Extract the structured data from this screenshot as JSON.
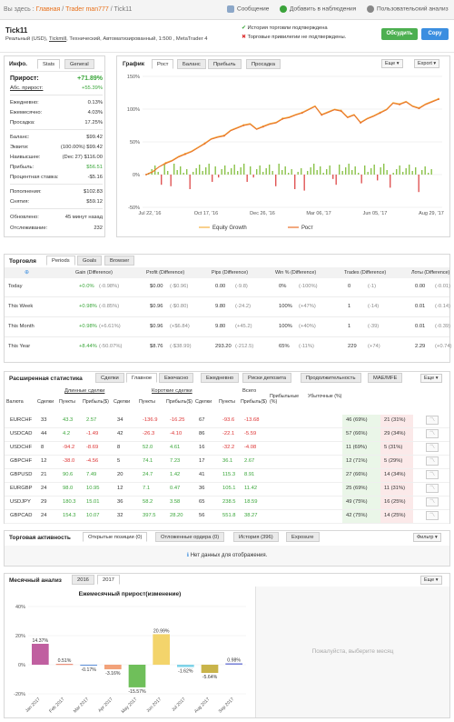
{
  "breadcrumb": {
    "prefix": "Вы здесь",
    "home": "Главная",
    "user": "Trader man777",
    "page": "Tick11"
  },
  "topbar": {
    "message": "Сообщение",
    "watch": "Добавить в наблюдения",
    "analysis": "Пользовательский анализ"
  },
  "account": {
    "name": "Tick11",
    "details_pre": "Реальный (USD), ",
    "broker": "Tickmill",
    "details_post": ", Технический, Автоматизированный, 1:500 , MetaTrader 4",
    "verify1": "История торговли подтверждена",
    "verify2": "Торговые привилегии не подтверждены.",
    "discuss": "Обсудить",
    "copy": "Copy"
  },
  "info": {
    "title": "Инфо.",
    "tabs": [
      "Stats",
      "General"
    ],
    "gain_label": "Прирост:",
    "gain": "+71.89%",
    "abs_label": "Абс. прирост:",
    "abs": "+55.39%",
    "daily_label": "Ежедневно:",
    "daily": "0.13%",
    "monthly_label": "Ежемесячно:",
    "monthly": "4.03%",
    "dd_label": "Просадка:",
    "dd": "17.25%",
    "balance_label": "Баланс:",
    "balance": "$99.42",
    "equity_label": "Эквити:",
    "equity_pct": "(100.00%)",
    "equity": "$99.42",
    "high_label": "Наивысшее:",
    "high_date": "(Dec 27)",
    "high": "$116.00",
    "profit_label": "Прибыль:",
    "profit": "$56.51",
    "interest_label": "Процентная ставка:",
    "interest": "-$5.16",
    "deposits_label": "Пополнения:",
    "deposits": "$102.83",
    "withdrawals_label": "Снятия:",
    "withdrawals": "$59.12",
    "updated_label": "Обновлено:",
    "updated": "45 минут назад",
    "tracking_label": "Отслеживание:",
    "tracking": "232"
  },
  "graph": {
    "title": "График",
    "tabs": [
      "Рост",
      "Баланс",
      "Прибыль",
      "Просадка"
    ],
    "menu1": "Еще",
    "menu2": "Export",
    "legend_equity": "Equity Growth",
    "legend_growth": "Рост"
  },
  "chart_data": [
    {
      "type": "line",
      "yticks": [
        "150%",
        "100%",
        "50%",
        "0%",
        "-50%"
      ],
      "ylim": [
        -50,
        150
      ],
      "xticks": [
        "Jul 22, '16",
        "Oct 17, '16",
        "Dec 26, '16",
        "Mar 06, '17",
        "Jun 05, '17",
        "Aug 29, '17"
      ],
      "series": [
        {
          "name": "Equity Growth",
          "values": [
            0,
            5,
            12,
            18,
            22,
            28,
            32,
            36,
            42,
            48,
            55,
            58,
            60,
            68,
            72,
            76,
            78,
            70,
            74,
            78,
            80,
            86,
            88,
            92,
            95,
            100,
            105,
            92,
            96,
            100,
            98,
            88,
            92,
            80,
            86,
            90,
            95,
            100,
            110,
            108,
            112,
            105,
            102,
            108,
            112,
            116
          ]
        },
        {
          "name": "Рост",
          "values": [
            0,
            4,
            12,
            17,
            21,
            27,
            31,
            35,
            41,
            47,
            54,
            57,
            59,
            67,
            71,
            75,
            77,
            69,
            73,
            77,
            79,
            85,
            87,
            91,
            94,
            99,
            104,
            91,
            95,
            99,
            97,
            87,
            91,
            79,
            85,
            89,
            94,
            99,
            109,
            107,
            111,
            104,
            101,
            107,
            111,
            115
          ]
        }
      ]
    },
    {
      "type": "bar",
      "title": "Ежемесячный прирост(изменение)",
      "categories": [
        "Jan 2017",
        "Feb 2017",
        "Mar 2017",
        "Apr 2017",
        "May 2017",
        "Jun 2017",
        "Jul 2017",
        "Aug 2017",
        "Sep 2017"
      ],
      "values": [
        14.37,
        0.51,
        -0.17,
        -3.16,
        -15.57,
        20.99,
        -1.62,
        -5.64,
        0.98
      ],
      "labels": [
        "14.37%",
        "0.51%",
        "-0.17%",
        "-3.16%",
        "-15.57%",
        "20.99%",
        "-1.62%",
        "-5.64%",
        "0.98%"
      ],
      "yticks": [
        "40%",
        "20%",
        "0%",
        "-20%"
      ],
      "ylim": [
        -20,
        40
      ]
    }
  ],
  "trading": {
    "title": "Торговля",
    "tabs": [
      "Periods",
      "Goals",
      "Browser"
    ],
    "headers": [
      "Gain (Difference)",
      "Profit (Difference)",
      "Pips (Difference)",
      "Win % (Difference)",
      "Trades (Difference)",
      "Лоты (Difference)"
    ],
    "rows": [
      {
        "label": "Today",
        "gain": "+0.0%",
        "gain_d": "(-0.98%)",
        "profit": "$0.00",
        "profit_d": "(-$0.96)",
        "pips": "0.00",
        "pips_d": "(-9.8)",
        "win": "0%",
        "win_d": "(-100%)",
        "trades": "0",
        "trades_d": "(-1)",
        "lots": "0.00",
        "lots_d": "(-0.01)"
      },
      {
        "label": "This Week",
        "gain": "+0.98%",
        "gain_d": "(-0.85%)",
        "profit": "$0.96",
        "profit_d": "(-$0.80)",
        "pips": "9.80",
        "pips_d": "(-24.2)",
        "win": "100%",
        "win_d": "(+47%)",
        "trades": "1",
        "trades_d": "(-14)",
        "lots": "0.01",
        "lots_d": "(-0.14)"
      },
      {
        "label": "This Month",
        "gain": "+0.98%",
        "gain_d": "(+6.61%)",
        "profit": "$0.96",
        "profit_d": "(+$6.84)",
        "pips": "9.80",
        "pips_d": "(+45.2)",
        "win": "100%",
        "win_d": "(+40%)",
        "trades": "1",
        "trades_d": "(-39)",
        "lots": "0.01",
        "lots_d": "(-0.39)"
      },
      {
        "label": "This Year",
        "gain": "+8.44%",
        "gain_d": "(-50.07%)",
        "profit": "$8.76",
        "profit_d": "(-$38.99)",
        "pips": "293.20",
        "pips_d": "(-212.5)",
        "win": "65%",
        "win_d": "(-11%)",
        "trades": "229",
        "trades_d": "(+74)",
        "lots": "2.29",
        "lots_d": "(+0.74)"
      }
    ]
  },
  "ext": {
    "title": "Расширенная статистика",
    "tabs": [
      "Сделки",
      "Главное",
      "Ежечасно",
      "Ежедневно",
      "Риски депозита",
      "Продолжительность",
      "MAE/MFE"
    ],
    "menu": "Еще",
    "group_long": "Длинные сделки",
    "group_short": "Короткие сделки",
    "group_all": "Всего",
    "headers": [
      "Валюта",
      "Сделки",
      "Пункты",
      "Прибыль($)",
      "Сделки",
      "Пункты",
      "Прибыль($)",
      "Сделки",
      "Пункты",
      "Прибыль($)",
      "Прибыльные (%)",
      "Убыточные (%)"
    ],
    "rows": [
      [
        "EURCHF",
        "33",
        "43.3",
        "2.57",
        "34",
        "-136.9",
        "-16.25",
        "67",
        "-93.6",
        "-13.68",
        "46 (69%)",
        "21 (31%)"
      ],
      [
        "USDCAD",
        "44",
        "4.2",
        "-1.49",
        "42",
        "-26.3",
        "-4.10",
        "86",
        "-22.1",
        "-5.59",
        "57 (66%)",
        "29 (34%)"
      ],
      [
        "USDCHF",
        "8",
        "-94.2",
        "-8.69",
        "8",
        "52.0",
        "4.61",
        "16",
        "-32.2",
        "-4.08",
        "11 (69%)",
        "5 (31%)"
      ],
      [
        "GBPCHF",
        "12",
        "-38.0",
        "-4.56",
        "5",
        "74.1",
        "7.23",
        "17",
        "36.1",
        "2.67",
        "12 (71%)",
        "5 (29%)"
      ],
      [
        "GBPUSD",
        "21",
        "90.6",
        "7.49",
        "20",
        "24.7",
        "1.42",
        "41",
        "115.3",
        "8.91",
        "27 (66%)",
        "14 (34%)"
      ],
      [
        "EURGBP",
        "24",
        "98.0",
        "10.95",
        "12",
        "7.1",
        "0.47",
        "36",
        "105.1",
        "11.42",
        "25 (69%)",
        "11 (31%)"
      ],
      [
        "USDJPY",
        "29",
        "180.3",
        "15.01",
        "36",
        "58.2",
        "3.58",
        "65",
        "238.5",
        "18.59",
        "49 (75%)",
        "16 (25%)"
      ],
      [
        "GBPCAD",
        "24",
        "154.3",
        "10.07",
        "32",
        "397.5",
        "28.20",
        "56",
        "551.8",
        "38.27",
        "42 (75%)",
        "14 (25%)"
      ]
    ]
  },
  "activity": {
    "title": "Торговая активность",
    "tabs": [
      "Открытые позиции (0)",
      "Отложенные ордера (0)",
      "История (396)",
      "Exposure"
    ],
    "filter": "Фильтр",
    "empty": "Нет данных для отображения."
  },
  "monthly": {
    "title": "Месячный анализ",
    "tabs": [
      "2016",
      "2017"
    ],
    "menu": "Еще",
    "placeholder": "Пожалуйста, выберите месяц"
  }
}
